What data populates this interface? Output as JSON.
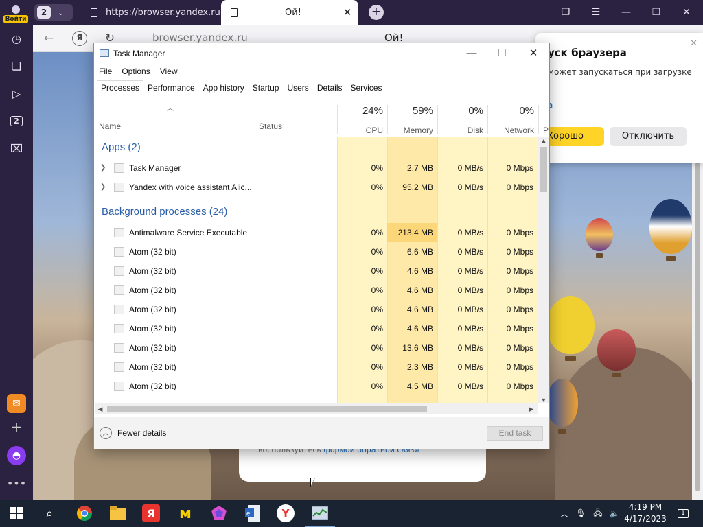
{
  "browser": {
    "login_label": "Войти",
    "tab_count": "2",
    "tabs": [
      {
        "title": "https://browser.yandex.ru/"
      },
      {
        "title": "Ой!"
      }
    ],
    "address": "browser.yandex.ru",
    "page_title": "Ой!",
    "sidebar_badge": "2",
    "notification": {
      "title": "уск браузера",
      "description": "может запускаться при загрузке",
      "link": "а",
      "ok_label": "Хорошо",
      "disable_label": "Отключить"
    },
    "feedback": {
      "prefix": "воспользуйтесь",
      "link": "формой обратной связи"
    }
  },
  "task_manager": {
    "title": "Task Manager",
    "menu": [
      "File",
      "Options",
      "View"
    ],
    "tabs": [
      "Processes",
      "Performance",
      "App history",
      "Startup",
      "Users",
      "Details",
      "Services"
    ],
    "columns": {
      "name": "Name",
      "status": "Status",
      "cpu": {
        "pct": "24%",
        "label": "CPU"
      },
      "memory": {
        "pct": "59%",
        "label": "Memory"
      },
      "disk": {
        "pct": "0%",
        "label": "Disk"
      },
      "network": {
        "pct": "0%",
        "label": "Network"
      },
      "power_cut": "P"
    },
    "groups": {
      "apps": "Apps (2)",
      "background": "Background processes (24)"
    },
    "apps": [
      {
        "name": "Task Manager",
        "cpu": "0%",
        "mem": "2.7 MB",
        "disk": "0 MB/s",
        "net": "0 Mbps"
      },
      {
        "name": "Yandex with voice assistant Alic...",
        "cpu": "0%",
        "mem": "95.2 MB",
        "disk": "0 MB/s",
        "net": "0 Mbps"
      }
    ],
    "background": [
      {
        "name": "Antimalware Service Executable",
        "cpu": "0%",
        "mem": "213.4 MB",
        "disk": "0 MB/s",
        "net": "0 Mbps"
      },
      {
        "name": "Atom (32 bit)",
        "cpu": "0%",
        "mem": "6.6 MB",
        "disk": "0 MB/s",
        "net": "0 Mbps"
      },
      {
        "name": "Atom (32 bit)",
        "cpu": "0%",
        "mem": "4.6 MB",
        "disk": "0 MB/s",
        "net": "0 Mbps"
      },
      {
        "name": "Atom (32 bit)",
        "cpu": "0%",
        "mem": "4.6 MB",
        "disk": "0 MB/s",
        "net": "0 Mbps"
      },
      {
        "name": "Atom (32 bit)",
        "cpu": "0%",
        "mem": "4.6 MB",
        "disk": "0 MB/s",
        "net": "0 Mbps"
      },
      {
        "name": "Atom (32 bit)",
        "cpu": "0%",
        "mem": "4.6 MB",
        "disk": "0 MB/s",
        "net": "0 Mbps"
      },
      {
        "name": "Atom (32 bit)",
        "cpu": "0%",
        "mem": "13.6 MB",
        "disk": "0 MB/s",
        "net": "0 Mbps"
      },
      {
        "name": "Atom (32 bit)",
        "cpu": "0%",
        "mem": "2.3 MB",
        "disk": "0 MB/s",
        "net": "0 Mbps"
      },
      {
        "name": "Atom (32 bit)",
        "cpu": "0%",
        "mem": "4.5 MB",
        "disk": "0 MB/s",
        "net": "0 Mbps"
      }
    ],
    "fewer_details": "Fewer details",
    "end_task": "End task"
  },
  "taskbar": {
    "time": "4:19 PM",
    "date": "4/17/2023",
    "notification_count": "1"
  },
  "colors": {
    "cpu_shade": "#fff4c4",
    "mem_shade": "#ffe9a8",
    "mem_hot": "#fcd77a",
    "link_blue": "#2a5ea8",
    "yandex_yellow": "#ffd426"
  }
}
